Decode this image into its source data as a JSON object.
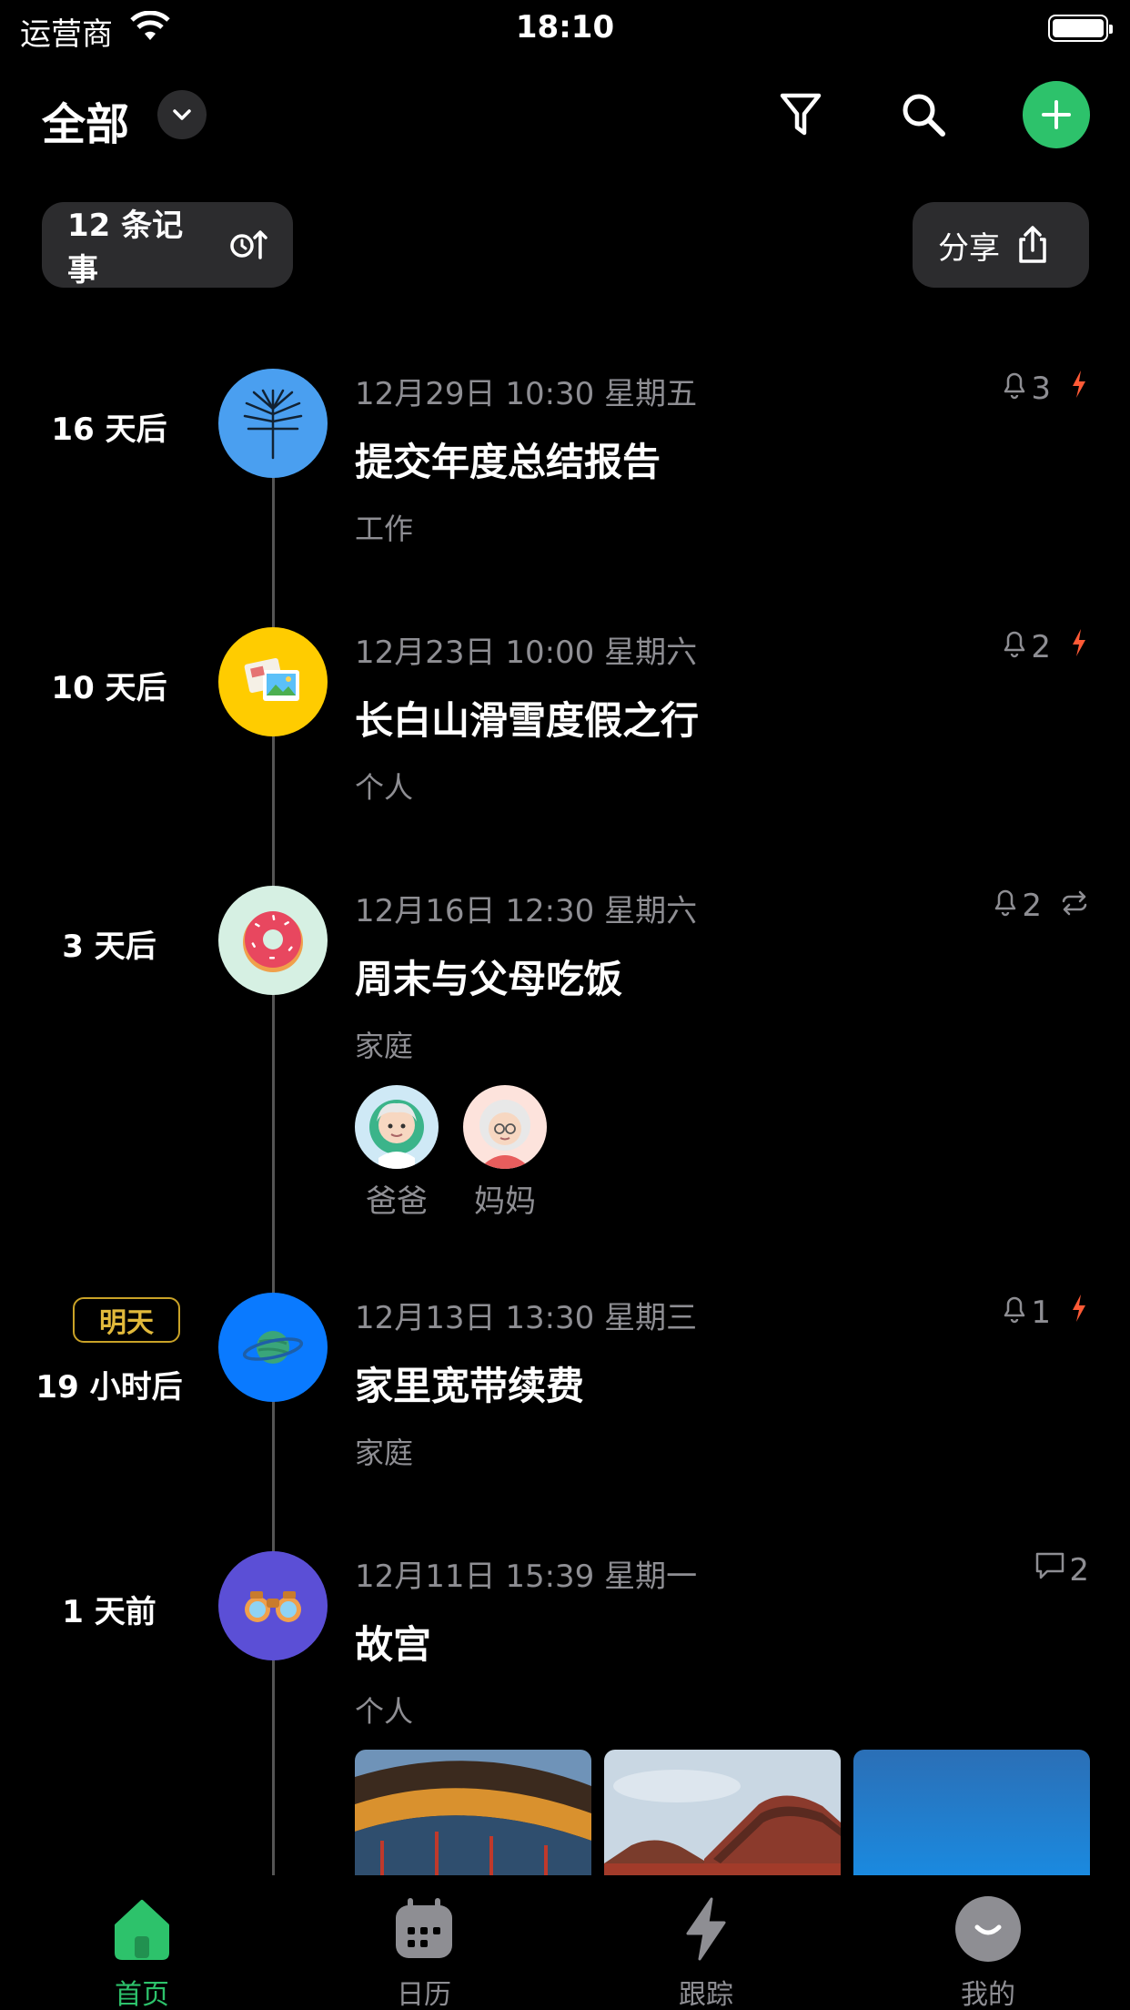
{
  "status_bar": {
    "carrier": "运营商",
    "time": "18:10"
  },
  "header": {
    "title": "全部"
  },
  "toolbar": {
    "count_label": "12 条记事",
    "share_label": "分享"
  },
  "events": [
    {
      "relative": "16 天后",
      "datetime": "12月29日 10:30 星期五",
      "title": "提交年度总结报告",
      "category": "工作",
      "reminders": "3",
      "icon": "palm-leaf-icon",
      "avatar_color": "#4a9ff0"
    },
    {
      "relative": "10 天后",
      "datetime": "12月23日 10:00 星期六",
      "title": "长白山滑雪度假之行",
      "category": "个人",
      "reminders": "2",
      "icon": "photos-icon",
      "avatar_color": "#ffcc00"
    },
    {
      "relative": "3 天后",
      "datetime": "12月16日 12:30 星期六",
      "title": "周末与父母吃饭",
      "category": "家庭",
      "reminders": "2",
      "icon": "donut-icon",
      "avatar_color": "#d6f0e3",
      "people": [
        {
          "name": "爸爸"
        },
        {
          "name": "妈妈"
        }
      ]
    },
    {
      "badge": "明天",
      "relative": "19 小时后",
      "datetime": "12月13日 13:30 星期三",
      "title": "家里宽带续费",
      "category": "家庭",
      "reminders": "1",
      "icon": "planet-icon",
      "avatar_color": "#0a7aff"
    },
    {
      "relative": "1 天前",
      "datetime": "12月11日 15:39 星期一",
      "title": "故宫",
      "category": "个人",
      "comments": "2",
      "icon": "binoculars-icon",
      "avatar_color": "#5b4fd6"
    }
  ],
  "tabs": [
    {
      "label": "首页",
      "icon": "home-icon",
      "active": true
    },
    {
      "label": "日历",
      "icon": "calendar-icon"
    },
    {
      "label": "跟踪",
      "icon": "bolt-icon"
    },
    {
      "label": "我的",
      "icon": "profile-icon"
    }
  ],
  "colors": {
    "accent": "#2dc26b",
    "urgent": "#ff5a36",
    "badge": "#e1b93b"
  }
}
